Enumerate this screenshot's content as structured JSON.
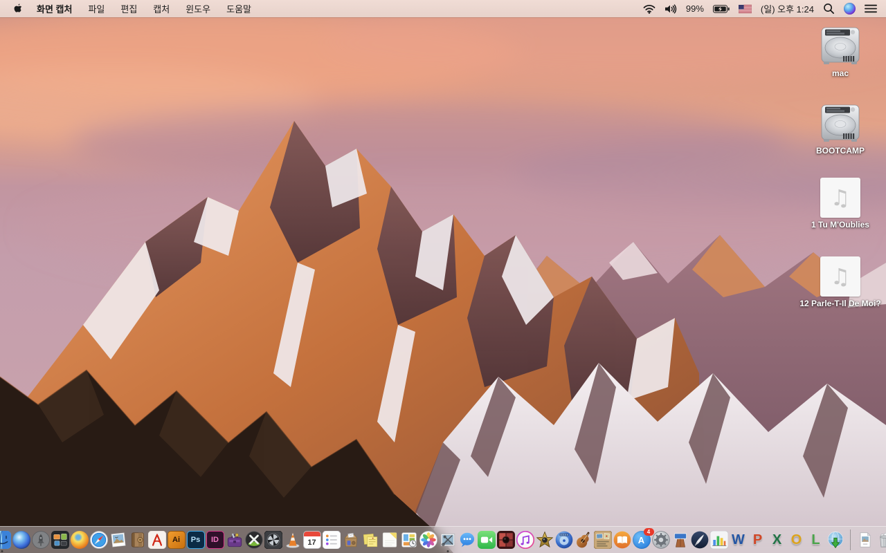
{
  "menu_bar": {
    "app_name": "화면 캡처",
    "menus": [
      "파일",
      "편집",
      "캡처",
      "윈도우",
      "도움말"
    ],
    "battery_percent": "99%",
    "clock": "(일) 오후 1:24",
    "status_icons": [
      "wifi-icon",
      "volume-icon",
      "battery-charging-icon",
      "us-flag-icon",
      "spotlight-search-icon",
      "siri-icon",
      "notification-center-icon"
    ]
  },
  "desktop": {
    "icons": [
      {
        "label": "mac",
        "type": "hard-drive"
      },
      {
        "label": "BOOTCAMP",
        "type": "hard-drive"
      },
      {
        "label": "1 Tu M'Oublies",
        "type": "audio-file"
      },
      {
        "label": "12 Parle-T-Il De Moi?",
        "type": "audio-file"
      }
    ]
  },
  "dock": {
    "calendar_day": "17",
    "app_store_badge": "4",
    "letters": {
      "illustrator": "Ai",
      "photoshop": "Ps",
      "indesign": "ID",
      "appstore": "A",
      "word": "W",
      "powerpoint": "P",
      "excel": "X",
      "outlook": "O",
      "lync": "L"
    },
    "running_apps": [
      "finder",
      "screen-capture"
    ],
    "items": [
      "finder",
      "siri",
      "launchpad",
      "mission-control",
      "firefox",
      "safari",
      "preview",
      "contacts",
      "acrobat",
      "illustrator",
      "photoshop",
      "indesign",
      "toolbox-utility",
      "x-utility",
      "fan-utility",
      "vlc",
      "calendar",
      "reminders",
      "mail-archive-box",
      "stickies",
      "notes",
      "docs-clock-utility",
      "photos",
      "screen-capture",
      "messages",
      "facetime",
      "photo-booth",
      "itunes",
      "imovie",
      "idvd",
      "garageband",
      "iweb",
      "ibooks",
      "app-store",
      "system-preferences",
      "keynote",
      "pages",
      "numbers",
      "word",
      "powerpoint",
      "excel",
      "outlook",
      "lync",
      "downloader",
      "screenshot-file",
      "trash"
    ]
  },
  "colors": {
    "menu_bar_bg": "#eed9d1",
    "dock_bg": "rgba(222,216,217,0.45)",
    "label_text": "#ffffff",
    "badge_red": "#e8382a"
  }
}
